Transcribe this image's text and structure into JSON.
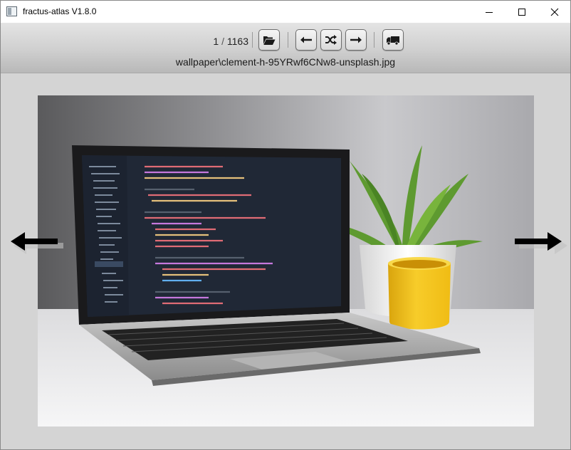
{
  "window": {
    "title": "fractus-atlas V1.8.0"
  },
  "toolbar": {
    "current_index": "1",
    "separator": "/",
    "total_count": "1163",
    "buttons": [
      {
        "name": "open-folder",
        "icon": "folder-open-icon"
      },
      {
        "name": "previous",
        "icon": "arrow-left-icon"
      },
      {
        "name": "shuffle",
        "icon": "shuffle-icon"
      },
      {
        "name": "next",
        "icon": "arrow-right-icon"
      },
      {
        "name": "move",
        "icon": "truck-icon"
      }
    ]
  },
  "image": {
    "path": "wallpaper\\clement-h-95YRwf6CNw8-unsplash.jpg",
    "content": "photo of a laptop showing a code editor, a potted plant and a yellow mug on a white desk"
  },
  "nav": {
    "left_icon": "arrow-left-icon",
    "right_icon": "arrow-right-icon"
  },
  "colors": {
    "background": "#d4d4d4",
    "toolbar_top": "#e4e4e4",
    "toolbar_bottom": "#b8b8b8",
    "mug": "#f2c21a",
    "plant": "#5e9a30"
  }
}
